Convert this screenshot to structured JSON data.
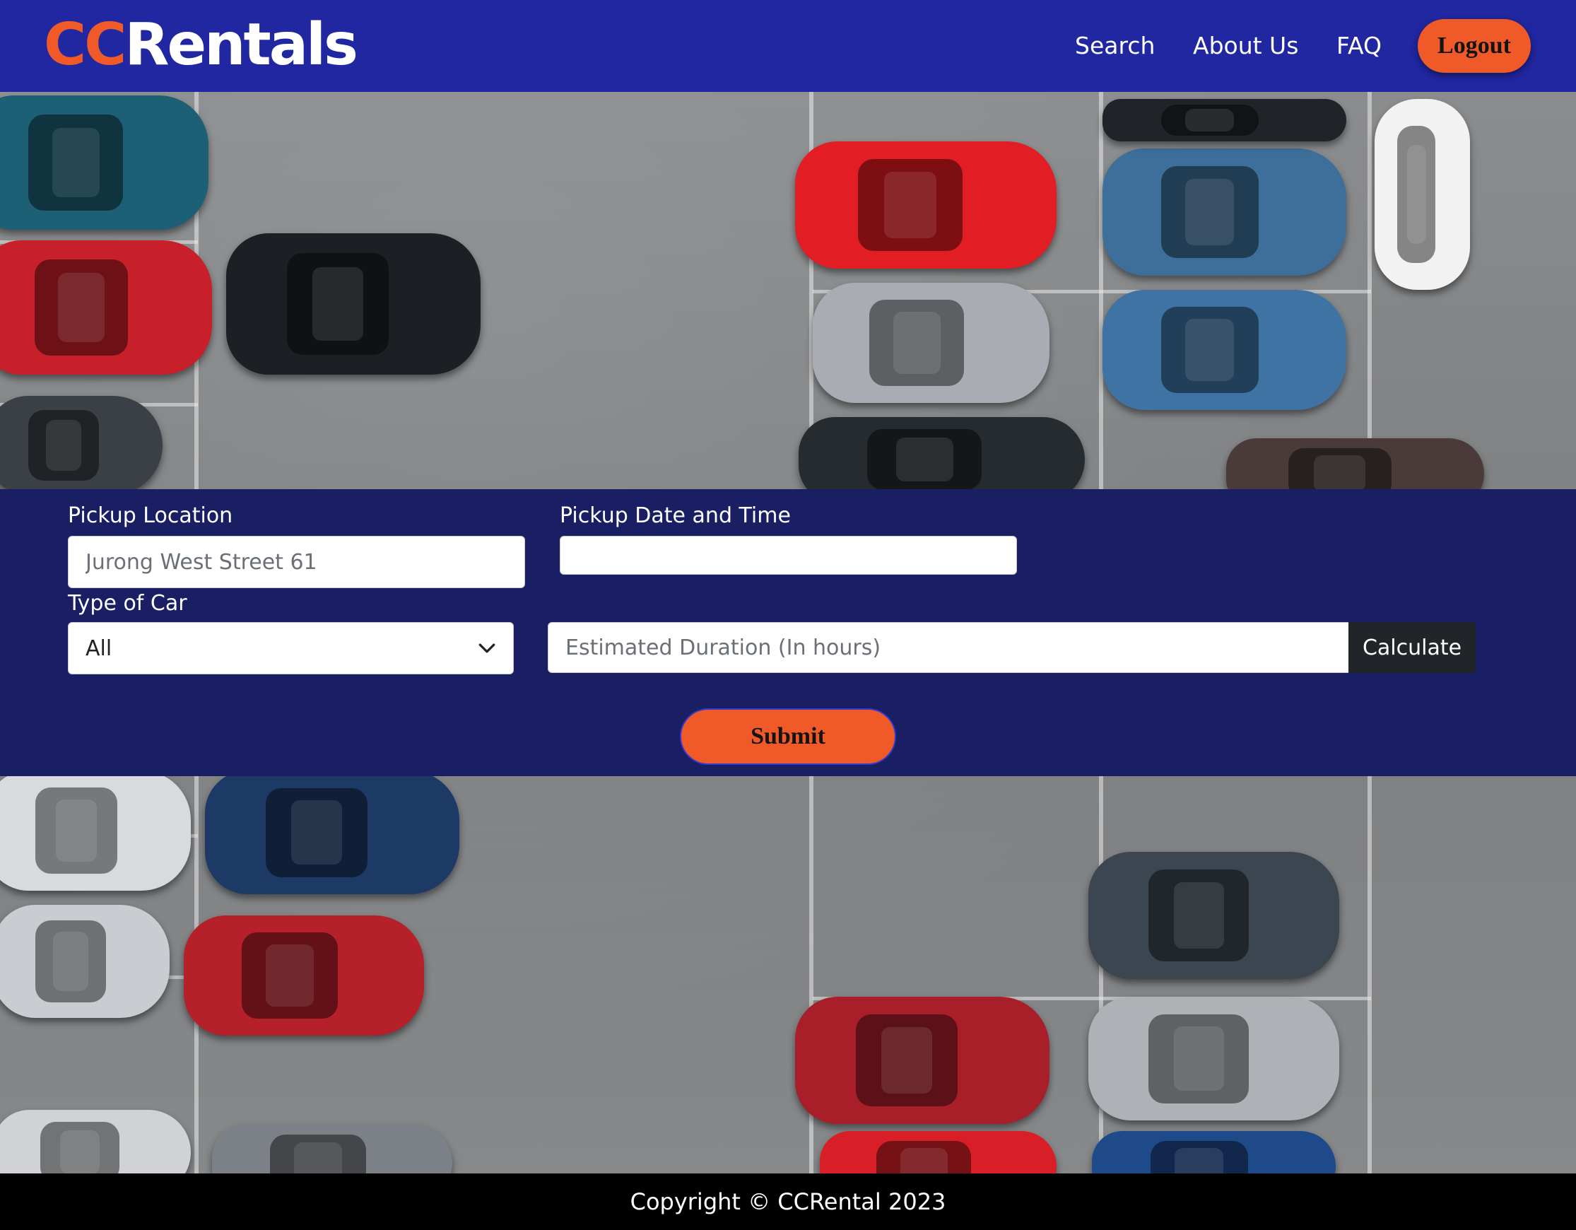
{
  "brand": {
    "part1": "CC",
    "part2": "Rentals"
  },
  "nav": {
    "links": [
      {
        "label": "Search"
      },
      {
        "label": "About Us"
      },
      {
        "label": "FAQ"
      }
    ],
    "logout_label": "Logout"
  },
  "form": {
    "pickup_location": {
      "label": "Pickup Location",
      "placeholder": "Jurong West Street 61",
      "value": ""
    },
    "pickup_datetime": {
      "label": "Pickup Date and Time",
      "value": ""
    },
    "car_type": {
      "label": "Type of Car",
      "selected": "All"
    },
    "duration": {
      "placeholder": "Estimated Duration (In hours)",
      "value": ""
    },
    "calculate_label": "Calculate",
    "submit_label": "Submit"
  },
  "footer": {
    "copyright": "Copyright © CCRental 2023"
  },
  "colors": {
    "navbar": "#2027a0",
    "accent": "#f05a28",
    "panel": "#1a1f63",
    "footer": "#000000"
  },
  "icons": {
    "select_arrow": "chevron-down-icon"
  }
}
